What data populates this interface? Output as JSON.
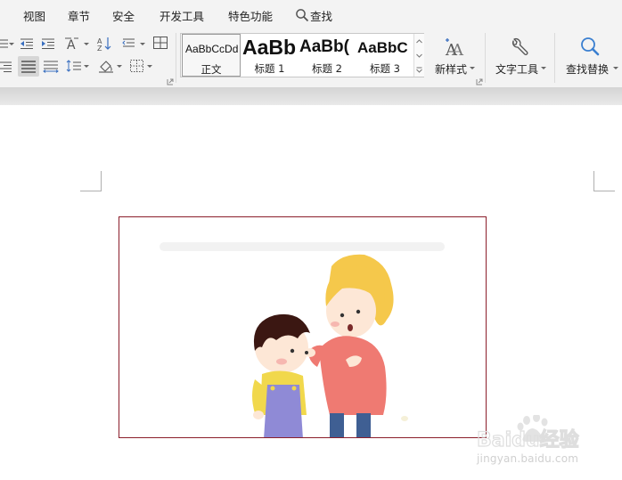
{
  "menu": {
    "items": [
      {
        "label": "视图"
      },
      {
        "label": "章节"
      },
      {
        "label": "安全"
      },
      {
        "label": "开发工具"
      },
      {
        "label": "特色功能"
      },
      {
        "label": "查找"
      }
    ]
  },
  "styles_gallery": {
    "items": [
      {
        "preview": "AaBbCcDd",
        "name": "正文",
        "selected": true
      },
      {
        "preview": "AaBb",
        "name": "标题 1"
      },
      {
        "preview": "AaBb(",
        "name": "标题 2"
      },
      {
        "preview": "AaBbC",
        "name": "标题 3"
      }
    ]
  },
  "ribbon": {
    "new_style_label": "新样式",
    "text_tools_label": "文字工具",
    "find_replace_label": "查找替换"
  },
  "document": {
    "image_description_icon": "cartoon-mother-and-son",
    "frame_color": "#8b1e2b"
  },
  "watermark": {
    "logo_text": "Baidu经验",
    "url": "jingyan.baidu.com"
  }
}
